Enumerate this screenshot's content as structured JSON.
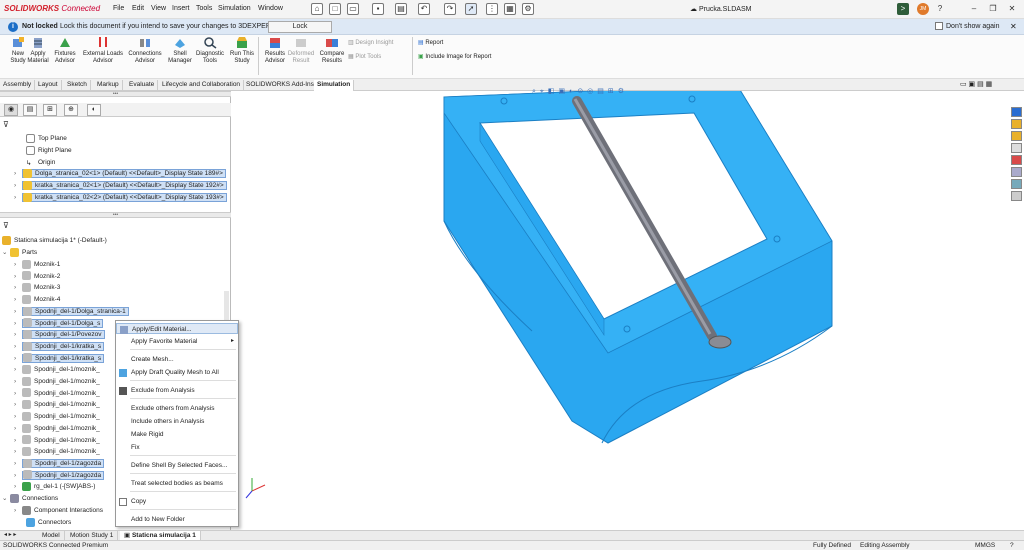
{
  "app": {
    "logo_brand": "SOLIDWORKS",
    "logo_suffix": "Connected",
    "doc_title": "Prucka.SLDASM",
    "avatar_initials": "JM"
  },
  "menu": [
    "File",
    "Edit",
    "View",
    "Insert",
    "Tools",
    "Simulation",
    "Window"
  ],
  "notice": {
    "bold": "Not locked",
    "text": "Lock this document if you intend to save your changes to 3DEXPERIENCE.",
    "lock_button": "Lock",
    "dont_show": "Don't show again"
  },
  "ribbon": {
    "buttons": [
      {
        "l1": "New",
        "l2": "Study"
      },
      {
        "l1": "Apply",
        "l2": "Material"
      },
      {
        "l1": "Fixtures",
        "l2": "Advisor"
      },
      {
        "l1": "External Loads",
        "l2": "Advisor"
      },
      {
        "l1": "Connections",
        "l2": "Advisor"
      },
      {
        "l1": "Shell",
        "l2": "Manager"
      },
      {
        "l1": "Diagnostic",
        "l2": "Tools"
      },
      {
        "l1": "Run This",
        "l2": "Study"
      },
      {
        "l1": "Results",
        "l2": "Advisor"
      },
      {
        "l1": "Deformed",
        "l2": "Result"
      },
      {
        "l1": "Compare",
        "l2": "Results"
      }
    ],
    "design_insight": "Design Insight",
    "plot_tools": "Plot Tools",
    "report": "Report",
    "include_image": "Include Image for Report"
  },
  "tabs": [
    "Assembly",
    "Layout",
    "Sketch",
    "Markup",
    "Evaluate",
    "Lifecycle and Collaboration",
    "SOLIDWORKS Add-Ins",
    "Simulation"
  ],
  "tabs_active": "Simulation",
  "feature_tree": {
    "top": [
      {
        "label": "Top Plane"
      },
      {
        "label": "Right Plane"
      },
      {
        "label": "Origin"
      },
      {
        "label": "Dolga_stranica_02<1> (Default) <<Default>_Display State 189#>"
      },
      {
        "label": "kratka_stranica_02<1> (Default) <<Default>_Display State 192#>"
      },
      {
        "label": "kratka_stranica_02<2> (Default) <<Default>_Display State 193#>"
      }
    ],
    "study": "Staticna simulacija 1* (-Default-)",
    "parts_label": "Parts",
    "parts": [
      "Moznik-1",
      "Moznik-2",
      "Moznik-3",
      "Moznik-4",
      "Spodnji_del-1/Dolga_stranica-1",
      "Spodnji_del-1/Dolga_s",
      "Spodnji_del-1/Povezov",
      "Spodnji_del-1/kratka_s",
      "Spodnji_del-1/kratka_s",
      "Spodnji_del-1/moznik_",
      "Spodnji_del-1/moznik_",
      "Spodnji_del-1/moznik_",
      "Spodnji_del-1/moznik_",
      "Spodnji_del-1/moznik_",
      "Spodnji_del-1/moznik_",
      "Spodnji_del-1/moznik_",
      "Spodnji_del-1/moznik_",
      "Spodnji_del-1/zagozda",
      "Spodnji_del-1/zagozda",
      "rg_del-1 (-[SW]ABS-)"
    ],
    "connections": "Connections",
    "component_interactions": "Component Interactions",
    "connectors": "Connectors"
  },
  "context_menu": [
    "Apply/Edit Material...",
    "Apply Favorite Material",
    "Create Mesh...",
    "Apply Draft Quality Mesh to All",
    "Exclude from Analysis",
    "Exclude others from Analysis",
    "Include others in Analysis",
    "Make Rigid",
    "Fix",
    "Define Shell By Selected Faces...",
    "Treat selected bodies as beams",
    "Copy",
    "Add to New Folder"
  ],
  "bottom_tabs": [
    "Model",
    "Motion Study 1",
    "Staticna simulacija 1"
  ],
  "bottom_tabs_active": "Staticna simulacija 1",
  "status": {
    "left": "SOLIDWORKS Connected Premium",
    "state": "Fully Defined",
    "mode": "Editing Assembly",
    "units": "MMGS"
  },
  "colors": {
    "model_blue": "#2aa7f0",
    "model_edge": "#1b7fc4",
    "rod": "#7b7d86",
    "brand": "#d3212d"
  }
}
